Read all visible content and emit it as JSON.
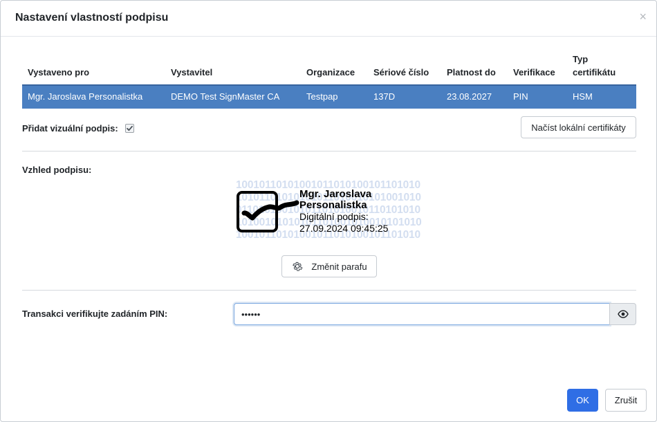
{
  "dialog": {
    "title": "Nastavení vlastností podpisu",
    "close_icon": "close-icon"
  },
  "table": {
    "headers": {
      "issued_to": "Vystaveno pro",
      "issuer": "Vystavitel",
      "organization": "Organizace",
      "serial": "Sériové číslo",
      "valid_to": "Platnost do",
      "verification": "Verifikace",
      "cert_type_line1": "Typ",
      "cert_type_line2": "certifikátu"
    },
    "rows": [
      {
        "issued_to": "Mgr. Jaroslava Personalistka",
        "issuer": "DEMO Test SignMaster CA",
        "organization": "Testpap",
        "serial": "137D",
        "valid_to": "23.08.2027",
        "verification": "PIN",
        "cert_type": "HSM"
      }
    ],
    "selected_row_color": "#4a7fc1"
  },
  "visual_signature": {
    "label": "Přidat vizuální podpis:",
    "checked": true
  },
  "load_local_button": "Načíst lokální certifikáty",
  "appearance": {
    "label": "Vzhled podpisu:",
    "preview": {
      "name_line1": "Mgr. Jaroslava",
      "name_line2": "Personalistka",
      "caption": "Digitální podpis:",
      "timestamp": "27.09.2024 09:45:25",
      "binary_rows": [
        "10010110101001011010100101101010",
        "10101101010101011010010101001010",
        "01101010010101101010010110101010",
        "10100101010101101001010010101010",
        "10010110101001011010100101101010"
      ]
    },
    "change_button": "Změnit parafu",
    "change_icon": "gear-icon"
  },
  "pin": {
    "label": "Transakci verifikujte zadáním PIN:",
    "value": "••••••",
    "toggle_icon": "eye-icon"
  },
  "footer": {
    "ok": "OK",
    "cancel": "Zrušit",
    "ok_color": "#2f6ee5"
  }
}
